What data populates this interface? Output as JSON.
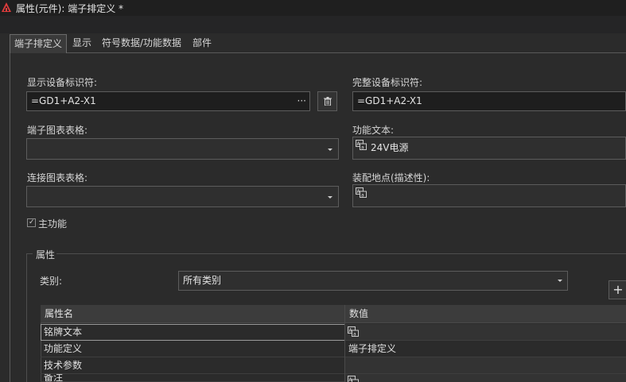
{
  "window": {
    "title": "属性(元件): 端子排定义 *"
  },
  "tabs": [
    {
      "label": "端子排定义",
      "active": true
    },
    {
      "label": "显示",
      "active": false
    },
    {
      "label": "符号数据/功能数据",
      "active": false
    },
    {
      "label": "部件",
      "active": false
    }
  ],
  "form": {
    "display_id_label": "显示设备标识符:",
    "display_id_value": "=GD1+A2-X1",
    "more_label": "···",
    "full_id_label": "完整设备标识符:",
    "full_id_value": "=GD1+A2-X1",
    "terminal_chart_label": "端子图表表格:",
    "terminal_chart_value": "",
    "function_text_label": "功能文本:",
    "function_text_value": "24V电源",
    "connection_chart_label": "连接图表表格:",
    "connection_chart_value": "",
    "mount_location_label": "装配地点(描述性):",
    "mount_location_value": "",
    "main_function_label": "主功能",
    "main_function_checked": true
  },
  "properties": {
    "group_label": "属性",
    "category_label": "类别:",
    "category_value": "所有类别",
    "add_label": "+",
    "columns": [
      "属性名",
      "数值"
    ],
    "rows": [
      {
        "name": "铭牌文本",
        "value": "",
        "multilang": true
      },
      {
        "name": "功能定义",
        "value": "端子排定义",
        "multilang": false
      },
      {
        "name": "技术参数",
        "value": "",
        "multilang": false
      },
      {
        "name": "备注",
        "value": "",
        "multilang": true
      }
    ]
  },
  "colors": {
    "accent_red": "#e03c3c",
    "background": "#2b2b2b"
  },
  "icons": {
    "app": "eplan-app-icon",
    "more": "ellipsis-icon",
    "delete": "trash-icon",
    "combo": "chevron-down-icon",
    "multilang": "multilanguage-text-icon"
  }
}
